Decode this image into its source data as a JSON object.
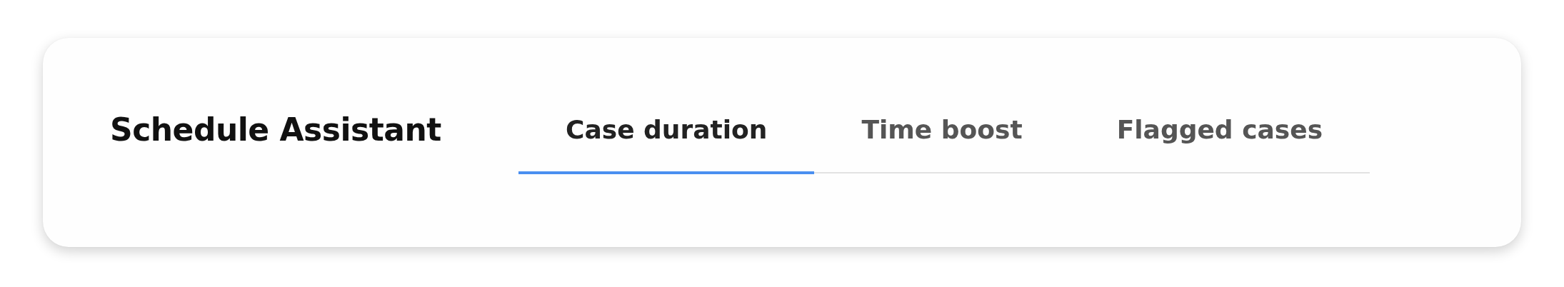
{
  "title": "Schedule Assistant",
  "tabs": [
    {
      "label": "Case duration",
      "selected": true
    },
    {
      "label": "Time boost",
      "selected": false
    },
    {
      "label": "Flagged cases",
      "selected": false
    }
  ]
}
